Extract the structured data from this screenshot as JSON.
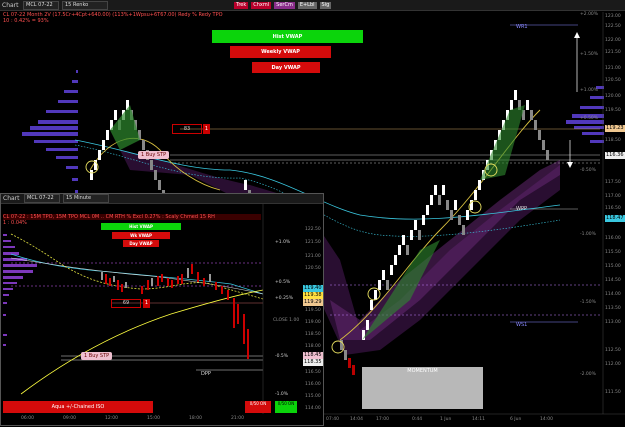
{
  "main": {
    "window_title": "Chart",
    "instrument": "MCL 07-22",
    "interval": "15 Renko",
    "toolbar_buttons": [
      {
        "label": "Trek",
        "color": "#b8002b"
      },
      {
        "label": "Chxml",
        "color": "#b8002b"
      },
      {
        "label": "SerCm",
        "color": "#8a2d8a"
      },
      {
        "label": "E+Lbl",
        "color": "#666"
      },
      {
        "label": "Sig",
        "color": "#666"
      }
    ],
    "info_line1": "CL 07-22 Month 2V (17.5Cr+4Cpt+640.00)  (113%+1Wpsu+6T67.00)  Redy %  Redy TPO",
    "info_line2": "10 : 0.42% = 93%",
    "vwap_labels": {
      "hist": "Hist VWAP",
      "weekly": "Weekly VWAP",
      "day": "Day VWAP"
    },
    "price_tags": {
      "top": "119.23",
      "bottom": "116.36",
      "wpp": "118.47"
    },
    "box_label": "83",
    "box_flag": "1",
    "buy_stop": "1 Buy STP",
    "levels": {
      "wr1": "WR1",
      "wpp": "WPP",
      "ws1": "WS1"
    },
    "pct_labels": [
      "+2.00%",
      "+1.50%",
      "+1.00%",
      "+0.50%",
      "-0.50%",
      "-1.00%",
      "-1.50%",
      "-2.00%"
    ],
    "y_axis": [
      "123.00",
      "122.50",
      "122.00",
      "121.50",
      "121.00",
      "120.50",
      "120.00",
      "119.50",
      "119.00",
      "118.50",
      "118.00",
      "117.50",
      "117.00",
      "116.50",
      "116.00",
      "115.50",
      "115.00",
      "114.50",
      "114.00",
      "113.50",
      "113.00",
      "112.50",
      "112.00",
      "111.50"
    ],
    "x_axis": [
      "07:40",
      "14:04",
      "17:00",
      "0:44",
      "1 Jun",
      "14:11",
      "6 Jun",
      "14:00"
    ],
    "momentum_label": "MOMENTUM"
  },
  "inset": {
    "window_title": "Chart",
    "instrument": "MCL 07-22",
    "interval": "15 Minute",
    "info_line1": "CL 07-22 : 15M TPO, 15M TPO MCL 0M .. CM RTH % Excl 0.27% : Scaly Chmed 15 RH",
    "info_line2": "1 : 0.04%",
    "vwap_labels": {
      "hist": "Hist VWAP",
      "wk": "Wk VWAP",
      "day": "Day VWAP"
    },
    "price_tags": {
      "a": "119.40",
      "b": "119.38",
      "c": "119.29",
      "d": "118.45",
      "e": "118.35"
    },
    "box_label": "69",
    "box_flag": "1",
    "buy_stop": "1 Buy STP",
    "dpp_label": "DPP",
    "close_label": "CLOSE 1.00",
    "pct_labels": [
      "+1.0%",
      "+0.5%",
      "+0.25%",
      "-0.5%",
      "-1.0%"
    ],
    "y_axis": [
      "122.50",
      "122.00",
      "121.50",
      "121.00",
      "120.50",
      "120.00",
      "119.50",
      "119.00",
      "118.50",
      "118.00",
      "117.50",
      "117.00",
      "116.50",
      "116.00",
      "115.50",
      "115.00",
      "114.50",
      "114.00"
    ],
    "x_axis": [
      "06:00",
      "09:00",
      "12:00",
      "15:00",
      "18:00",
      "21:00"
    ],
    "footer_left": "Aqua +/-Chained ISO",
    "footer_b1": "0/50 ON",
    "footer_b2": "0/50 ON"
  }
}
